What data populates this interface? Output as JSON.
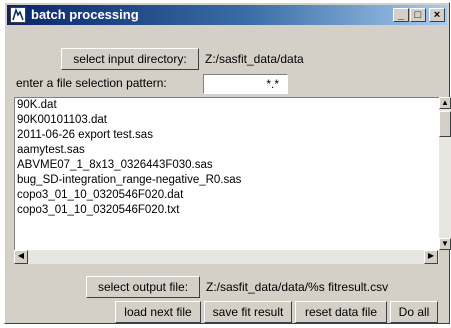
{
  "window": {
    "title": "batch processing",
    "controls": {
      "minimize": "_",
      "maximize": "□",
      "close": "×"
    }
  },
  "input_dir": {
    "button_label": "select input directory:",
    "value": "Z:/sasfit_data/data"
  },
  "pattern": {
    "label": "enter a file selection pattern:",
    "value": "*.*"
  },
  "files": [
    "90K.dat",
    "90K00101103.dat",
    "2011-06-26 export test.sas",
    "aamytest.sas",
    "ABVME07_1_8x13_0326443F030.sas",
    "bug_SD-integration_range-negative_R0.sas",
    "copo3_01_10_0320546F020.dat",
    "copo3_01_10_0320546F020.txt"
  ],
  "scroll_glyphs": {
    "up": "▲",
    "down": "▼",
    "left": "◀",
    "right": "▶"
  },
  "output": {
    "button_label": "select output file:",
    "value": "Z:/sasfit_data/data/%s fitresult.csv"
  },
  "actions": {
    "load_next": "load next file",
    "save_fit": "save fit result",
    "reset_data": "reset data file",
    "do_all": "Do all"
  }
}
